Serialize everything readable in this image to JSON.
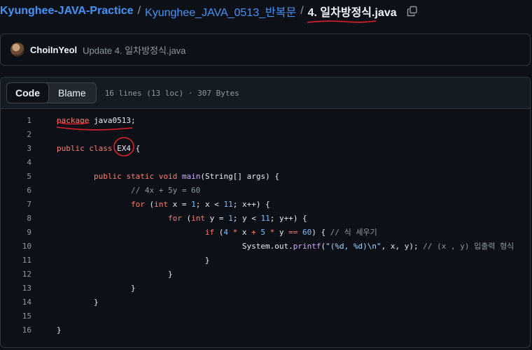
{
  "breadcrumb": {
    "repo": "Kyunghee-JAVA-Practice",
    "folder": "Kyunghee_JAVA_0513_반복문",
    "file": "4. 일차방정식.java",
    "separator": "/"
  },
  "commit": {
    "author": "ChoiInYeol",
    "message": "Update 4. 일차방정식.java"
  },
  "file_header": {
    "tabs": [
      "Code",
      "Blame"
    ],
    "active_tab": "Code",
    "meta": "16 lines (13 loc) · 307 Bytes"
  },
  "code_lines": [
    {
      "n": "1",
      "tokens": [
        [
          "kw",
          "package"
        ],
        [
          "tk",
          " java0513;"
        ]
      ]
    },
    {
      "n": "2",
      "tokens": []
    },
    {
      "n": "3",
      "tokens": [
        [
          "kw",
          "public"
        ],
        [
          "tk",
          " "
        ],
        [
          "kw",
          "class"
        ],
        [
          "tk",
          " EX4 {"
        ]
      ]
    },
    {
      "n": "4",
      "tokens": []
    },
    {
      "n": "5",
      "tokens": [
        [
          "tk",
          "        "
        ],
        [
          "kw",
          "public"
        ],
        [
          "tk",
          " "
        ],
        [
          "kw",
          "static"
        ],
        [
          "tk",
          " "
        ],
        [
          "kw",
          "void"
        ],
        [
          "tk",
          " "
        ],
        [
          "fn",
          "main"
        ],
        [
          "tk",
          "(String[] args) {"
        ]
      ]
    },
    {
      "n": "6",
      "tokens": [
        [
          "tk",
          "                "
        ],
        [
          "cm",
          "// 4x + 5y = 60"
        ]
      ]
    },
    {
      "n": "7",
      "tokens": [
        [
          "tk",
          "                "
        ],
        [
          "kw",
          "for"
        ],
        [
          "tk",
          " ("
        ],
        [
          "kw",
          "int"
        ],
        [
          "tk",
          " x = "
        ],
        [
          "num",
          "1"
        ],
        [
          "tk",
          "; x < "
        ],
        [
          "num",
          "11"
        ],
        [
          "tk",
          "; x++) {"
        ]
      ]
    },
    {
      "n": "8",
      "tokens": [
        [
          "tk",
          "                        "
        ],
        [
          "kw",
          "for"
        ],
        [
          "tk",
          " ("
        ],
        [
          "kw",
          "int"
        ],
        [
          "tk",
          " y = "
        ],
        [
          "num",
          "1"
        ],
        [
          "tk",
          "; y < "
        ],
        [
          "num",
          "11"
        ],
        [
          "tk",
          "; y++) {"
        ]
      ]
    },
    {
      "n": "9",
      "tokens": [
        [
          "tk",
          "                                "
        ],
        [
          "kw",
          "if"
        ],
        [
          "tk",
          " ("
        ],
        [
          "num",
          "4"
        ],
        [
          "tk",
          " "
        ],
        [
          "kw",
          "*"
        ],
        [
          "tk",
          " x "
        ],
        [
          "kw",
          "+"
        ],
        [
          "tk",
          " "
        ],
        [
          "num",
          "5"
        ],
        [
          "tk",
          " "
        ],
        [
          "kw",
          "*"
        ],
        [
          "tk",
          " y "
        ],
        [
          "kw",
          "=="
        ],
        [
          "tk",
          " "
        ],
        [
          "num",
          "60"
        ],
        [
          "tk",
          ") { "
        ],
        [
          "cm",
          "// 식 세우기"
        ]
      ]
    },
    {
      "n": "10",
      "tokens": [
        [
          "tk",
          "                                        System.out."
        ],
        [
          "fn",
          "printf"
        ],
        [
          "tk",
          "("
        ],
        [
          "str",
          "\"(%d, %d)\\n\""
        ],
        [
          "tk",
          ", x, y); "
        ],
        [
          "cm",
          "// (x , y) 입출력 형식"
        ]
      ]
    },
    {
      "n": "11",
      "tokens": [
        [
          "tk",
          "                                }"
        ]
      ]
    },
    {
      "n": "12",
      "tokens": [
        [
          "tk",
          "                        }"
        ]
      ]
    },
    {
      "n": "13",
      "tokens": [
        [
          "tk",
          "                }"
        ]
      ]
    },
    {
      "n": "14",
      "tokens": [
        [
          "tk",
          "        }"
        ]
      ]
    },
    {
      "n": "15",
      "tokens": []
    },
    {
      "n": "16",
      "tokens": [
        [
          "tk",
          "}"
        ]
      ]
    }
  ],
  "colors": {
    "link": "#4493f8",
    "keyword": "#ff7b72",
    "function": "#d2a8ff",
    "number": "#79c0ff",
    "string": "#a5d6ff",
    "comment": "#9198a1",
    "annotation_ink": "#e0212b"
  }
}
